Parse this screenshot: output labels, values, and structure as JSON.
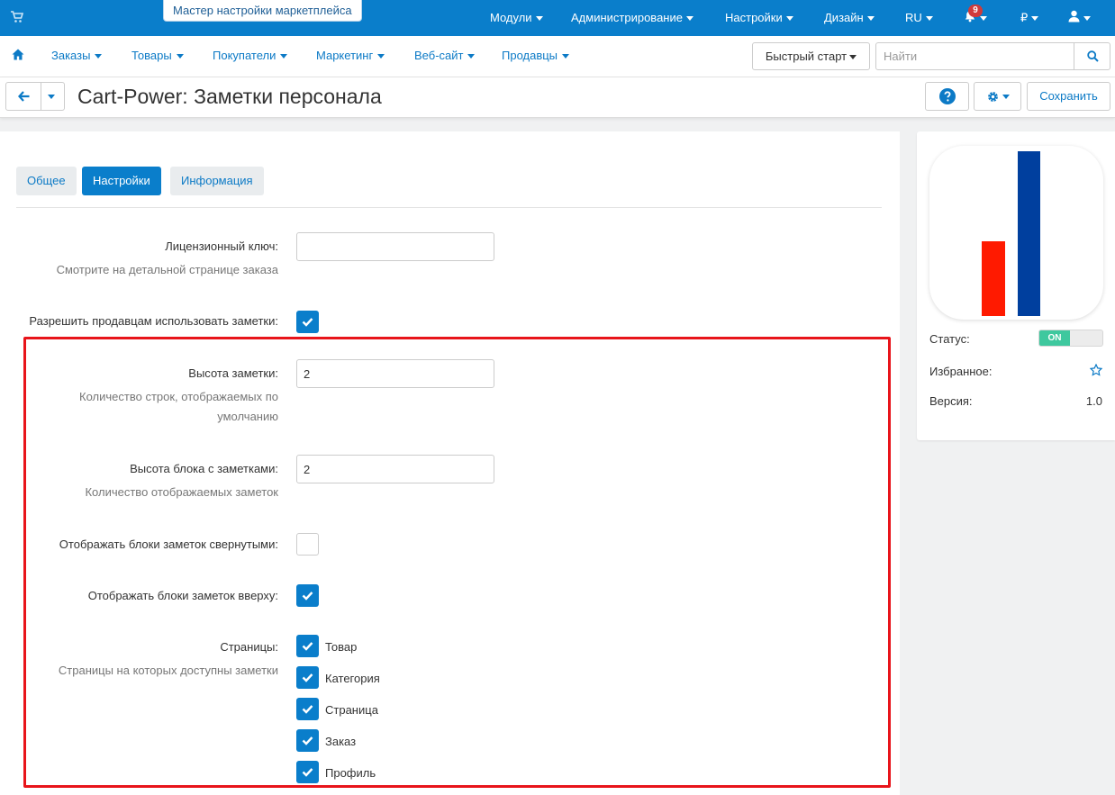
{
  "topbar": {
    "wizard_label": "Мастер настройки маркетплейса",
    "menu": [
      "Модули",
      "Администрирование",
      "Настройки",
      "Дизайн",
      "RU"
    ],
    "notifications_count": "9",
    "currency": "₽"
  },
  "nav": {
    "items": [
      "Заказы",
      "Товары",
      "Покупатели",
      "Маркетинг",
      "Веб-сайт",
      "Продавцы"
    ],
    "quick_start_label": "Быстрый старт",
    "search_placeholder": "Найти"
  },
  "header": {
    "title": "Cart-Power: Заметки персонала",
    "save_label": "Сохранить"
  },
  "tabs": [
    {
      "label": "Общее",
      "active": false
    },
    {
      "label": "Настройки",
      "active": true
    },
    {
      "label": "Информация",
      "active": false
    }
  ],
  "settings": {
    "license": {
      "label": "Лицензионный ключ:",
      "hint": "Смотрите на детальной странице заказа",
      "value": ""
    },
    "allow_vendors": {
      "label": "Разрешить продавцам использовать заметки:",
      "checked": true
    },
    "note_height": {
      "label": "Высота заметки:",
      "hint": "Количество строк, отображаемых по умолчанию",
      "value": "2"
    },
    "block_height": {
      "label": "Высота блока с заметками:",
      "hint": "Количество отображаемых заметок",
      "value": "2"
    },
    "collapsed": {
      "label": "Отображать блоки заметок свернутыми:",
      "checked": false
    },
    "on_top": {
      "label": "Отображать блоки заметок вверху:",
      "checked": true
    },
    "pages": {
      "label": "Страницы:",
      "hint": "Страницы на которых доступны заметки",
      "options": [
        {
          "label": "Товар",
          "checked": true
        },
        {
          "label": "Категория",
          "checked": true
        },
        {
          "label": "Страница",
          "checked": true
        },
        {
          "label": "Заказ",
          "checked": true
        },
        {
          "label": "Профиль",
          "checked": true
        }
      ]
    }
  },
  "sidebar": {
    "status_label": "Статус:",
    "status_value": "ON",
    "favorite_label": "Избранное:",
    "version_label": "Версия:",
    "version_value": "1.0"
  },
  "colors": {
    "primary": "#0a7ecb",
    "highlight_border": "#e8141a",
    "logo_red": "#ff1a00",
    "logo_blue": "#003f9e",
    "status_on": "#3ec89e"
  }
}
